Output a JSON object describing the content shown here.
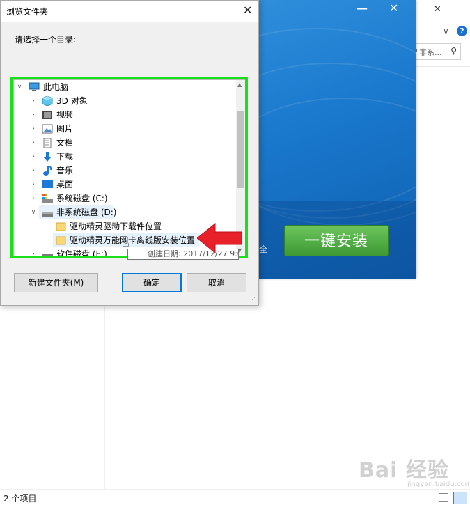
{
  "explorer": {
    "status_text": "2 个项目",
    "search_placeholder": "\"非系...",
    "help_icon": "?",
    "watermark": "Bai 经验",
    "watermark_sub": "jingyan.baidu.com"
  },
  "installer": {
    "install_button": "一键安装",
    "safe_text": "全"
  },
  "dialog": {
    "title": "浏览文件夹",
    "prompt": "请选择一个目录:",
    "tree": [
      {
        "label": "此电脑",
        "icon": "computer-icon",
        "expander": "expanded"
      },
      {
        "label": "3D 对象",
        "icon": "3d-objects-icon",
        "expander": "collapsed"
      },
      {
        "label": "视频",
        "icon": "video-icon",
        "expander": "collapsed"
      },
      {
        "label": "图片",
        "icon": "pictures-icon",
        "expander": "collapsed"
      },
      {
        "label": "文档",
        "icon": "documents-icon",
        "expander": "collapsed"
      },
      {
        "label": "下载",
        "icon": "download-icon",
        "expander": "collapsed"
      },
      {
        "label": "音乐",
        "icon": "music-icon",
        "expander": "collapsed"
      },
      {
        "label": "桌面",
        "icon": "desktop-icon",
        "expander": "collapsed"
      },
      {
        "label": "系统磁盘 (C:)",
        "icon": "system-drive-icon",
        "expander": "collapsed"
      },
      {
        "label": "非系统磁盘 (D:)",
        "icon": "drive-icon",
        "expander": "expanded"
      },
      {
        "label": "驱动精灵驱动下载件位置",
        "icon": "folder-icon",
        "expander": "none"
      },
      {
        "label": "驱动精灵万能网卡离线版安装位置",
        "icon": "folder-icon",
        "expander": "none"
      },
      {
        "label": "软件磁盘 (E:)",
        "icon": "drive-icon",
        "expander": "collapsed"
      }
    ],
    "tooltip": "创建日期: 2017/12/27 9:09",
    "buttons": {
      "new_folder": "新建文件夹(M)",
      "ok": "确定",
      "cancel": "取消"
    },
    "colors": {
      "highlight_border": "#19e019",
      "arrow": "#e8202a"
    }
  }
}
